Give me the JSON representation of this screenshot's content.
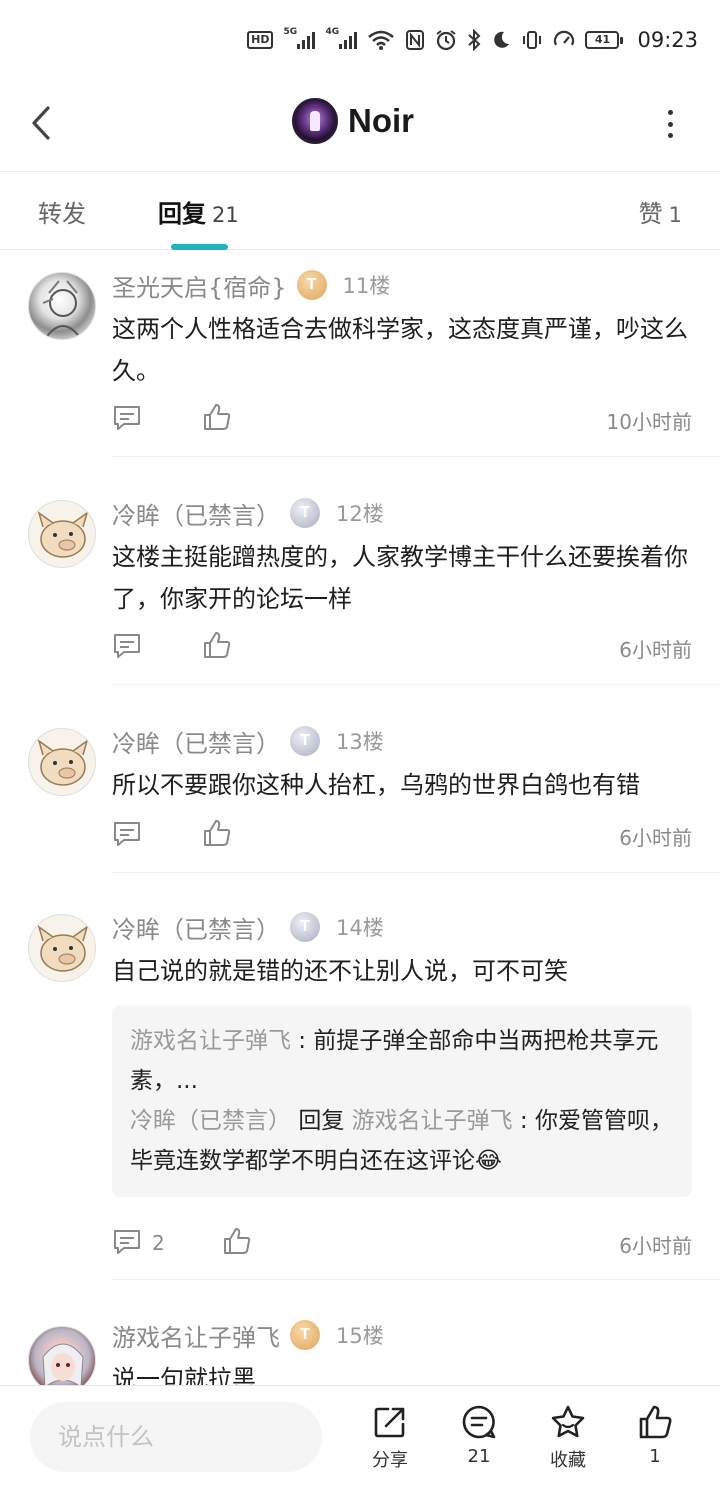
{
  "status_bar": {
    "hd": "HD",
    "sim1_network": "5G",
    "sim2_network": "4G",
    "battery": "41",
    "time": "09:23",
    "icons": [
      "hd-icon",
      "signal-5g-icon",
      "signal-4g-icon",
      "wifi-icon",
      "nfc-icon",
      "alarm-icon",
      "bluetooth-icon",
      "moon-icon",
      "vibrate-icon",
      "speed-icon",
      "battery-icon"
    ]
  },
  "header": {
    "title": "Noir",
    "icons": [
      "back-arrow-icon",
      "more-dots-icon"
    ]
  },
  "tabs": {
    "forward": {
      "label": "转发"
    },
    "reply": {
      "label": "回复",
      "count": "21"
    },
    "like": {
      "label": "赞",
      "count": "1"
    },
    "accent_color": "#1fb3c2"
  },
  "comments": [
    {
      "name": "圣光天启{宿命}",
      "badge": "T",
      "badge_color": "gold",
      "floor": "11楼",
      "text": "这两个人性格适合去做科学家，这态度真严谨，吵这么久。",
      "time": "10小时前",
      "reply_count": ""
    },
    {
      "name": "冷眸（已禁言）",
      "badge": "T",
      "badge_color": "silver",
      "floor": "12楼",
      "text": "这楼主挺能蹭热度的，人家教学博主干什么还要挨着你了，你家开的论坛一样",
      "time": "6小时前",
      "reply_count": ""
    },
    {
      "name": "冷眸（已禁言）",
      "badge": "T",
      "badge_color": "silver",
      "floor": "13楼",
      "text": "所以不要跟你这种人抬杠，乌鸦的世界白鸽也有错",
      "time": "6小时前",
      "reply_count": ""
    },
    {
      "name": "冷眸（已禁言）",
      "badge": "T",
      "badge_color": "silver",
      "floor": "14楼",
      "text": "自己说的就是错的还不让别人说，可不可笑",
      "time": "6小时前",
      "reply_count": "2",
      "quotes": {
        "q1_name": "游戏名让子弹飞",
        "q1_text": "前提子弹全部命中当两把枪共享元素，...",
        "q2_name": "冷眸（已禁言）",
        "q2_reply_word": "回复",
        "q2_target": "游戏名让子弹飞",
        "q2_text": "你爱管管呗，毕竟连数学都学不明白还在这评论😂"
      }
    },
    {
      "name": "游戏名让子弹飞",
      "badge": "T",
      "badge_color": "gold",
      "floor": "15楼",
      "text": "说一句就拉黑"
    }
  ],
  "bottom_bar": {
    "input_placeholder": "说点什么",
    "share_label": "分享",
    "comment_count": "21",
    "favorite_label": "收藏",
    "like_count": "1"
  }
}
